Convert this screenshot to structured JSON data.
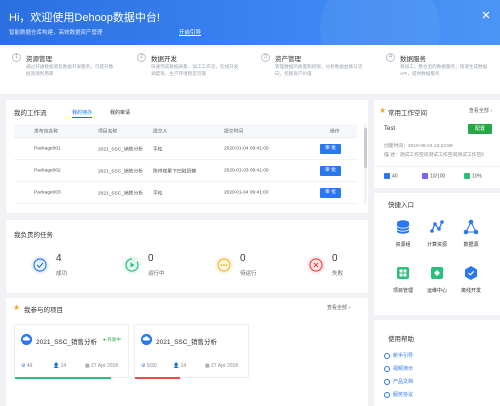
{
  "banner": {
    "title": "Hi，欢迎使用Dehoop数据中台!",
    "subtitle": "智能数据仓库构建，高效数据资产管理",
    "start_link": "开启引导"
  },
  "steps": [
    {
      "num": "1",
      "title": "资源管理",
      "desc": "通过开通数据源及数据开发服务，可提升数据资源利用率"
    },
    {
      "num": "2",
      "title": "数据开发",
      "desc": "快速完成数据采集、加工工作流，在线开发调度等，生产环境稳定可靠"
    },
    {
      "num": "3",
      "title": "资产管理",
      "desc": "管理数据的质量和权限，分析数据血缘与流向，挖掘资产价值"
    },
    {
      "num": "4",
      "title": "数据服务",
      "desc": "将加工、整合后的数据服务，快速生成数据API，提供数据服务"
    }
  ],
  "workflow": {
    "title": "我的工作流",
    "tabs": [
      "我的待办",
      "我的审请"
    ],
    "columns": [
      "发布包名称",
      "项目名称",
      "提交人",
      "提交时间",
      "操作"
    ],
    "rows": [
      {
        "pkg": "Package001",
        "project": "2021_SSC_销售分析",
        "user": "平松",
        "time": "2020-01-04  09:41:00",
        "action": "审 批"
      },
      {
        "pkg": "Package002",
        "project": "2021_SSC_销售分析",
        "user": "陈祥楼累下凹陷奶糖",
        "time": "2020-01-03  09:41:00",
        "action": "审 批"
      },
      {
        "pkg": "Package003",
        "project": "2021_SSC_销售分析",
        "user": "平松",
        "time": "2020-01-04  09:41:00",
        "action": "审 批"
      }
    ]
  },
  "tasks": {
    "title": "我负责的任务",
    "items": [
      {
        "value": "4",
        "label": "成功",
        "color": "#2a78f0"
      },
      {
        "value": "0",
        "label": "运行中",
        "color": "#28c07a"
      },
      {
        "value": "0",
        "label": "待运行",
        "color": "#f5b731"
      },
      {
        "value": "0",
        "label": "失败",
        "color": "#f04848"
      }
    ]
  },
  "projects": {
    "title": "我参与的项目",
    "more": "查看全部",
    "items": [
      {
        "name": "2021_SSC_销售分析",
        "badge": "● 开发中",
        "a": "49",
        "b": "14",
        "date": "27 Apr 2018",
        "bar_color": "#28c07a",
        "progress": 0.85
      },
      {
        "name": "2021_SSC_销售分析",
        "badge": "",
        "a": "5/30",
        "b": "14",
        "date": "27 Apr 2018",
        "bar_color": "#f04848",
        "progress": 0.4
      }
    ]
  },
  "workspace": {
    "title": "常用工作空间",
    "more": "查看全部",
    "name": "Test",
    "config_label": "配置",
    "created": "创建时间：2019-08-24 13:24:59",
    "desc": "描    述：测试工作空间测试工作空间测试工作空间",
    "stats": [
      "40",
      "10/100",
      "10%"
    ]
  },
  "quick": {
    "title": "快捷入口",
    "items": [
      {
        "label": "资源组",
        "icon": "database-icon"
      },
      {
        "label": "计算资源",
        "icon": "compute-nodes-icon"
      },
      {
        "label": "数据源",
        "icon": "datasource-icon"
      },
      {
        "label": "项目管理",
        "icon": "project-icon"
      },
      {
        "label": "运维中心",
        "icon": "ops-center-icon"
      },
      {
        "label": "离线开发",
        "icon": "offline-dev-icon"
      }
    ]
  },
  "help": {
    "title": "使用帮助",
    "items": [
      "新手引导",
      "视频演示",
      "产品文档",
      "服务协议"
    ]
  }
}
